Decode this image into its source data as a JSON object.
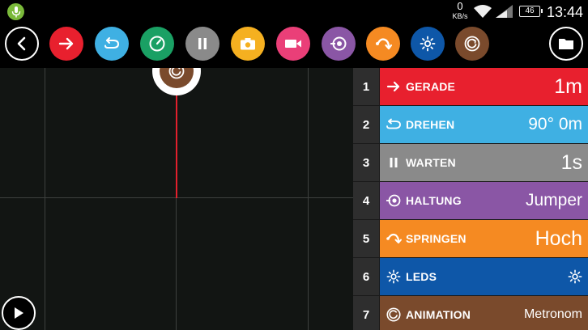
{
  "status_bar": {
    "net_speed_value": "0",
    "net_speed_unit": "KB/s",
    "battery_level": "46",
    "time": "13:44"
  },
  "colors": {
    "red": "#e8202e",
    "light_blue": "#3fb0e3",
    "green": "#1aa064",
    "gray": "#8a8a8a",
    "yellow": "#f5b020",
    "pink": "#ea3f78",
    "purple": "#8a56a5",
    "orange": "#f58a22",
    "blue": "#0e57a8",
    "brown": "#7a4a2c"
  },
  "toolbar": {
    "buttons": [
      {
        "icon": "back-icon"
      },
      {
        "icon": "arrow-right-icon",
        "color": "#e8202e"
      },
      {
        "icon": "rotate-icon",
        "color": "#3fb0e3"
      },
      {
        "icon": "speedometer-icon",
        "color": "#1aa064"
      },
      {
        "icon": "pause-icon",
        "color": "#8a8a8a"
      },
      {
        "icon": "camera-icon",
        "color": "#f5b020"
      },
      {
        "icon": "video-icon",
        "color": "#ea3f78"
      },
      {
        "icon": "posture-icon",
        "color": "#8a56a5"
      },
      {
        "icon": "jump-icon",
        "color": "#f58a22"
      },
      {
        "icon": "leds-icon",
        "color": "#0e57a8"
      },
      {
        "icon": "animation-icon",
        "color": "#7a4a2c"
      },
      {
        "icon": "folder-icon"
      }
    ]
  },
  "commands": [
    {
      "number": "1",
      "label": "GERADE",
      "value": "1m",
      "icon": "arrow-right-icon",
      "color": "#e8202e"
    },
    {
      "number": "2",
      "label": "DREHEN",
      "value": "90° 0m",
      "icon": "rotate-icon",
      "color": "#3fb0e3"
    },
    {
      "number": "3",
      "label": "WARTEN",
      "value": "1s",
      "icon": "pause-icon",
      "color": "#8a8a8a"
    },
    {
      "number": "4",
      "label": "HALTUNG",
      "value": "Jumper",
      "icon": "posture-icon",
      "color": "#8a56a5"
    },
    {
      "number": "5",
      "label": "SPRINGEN",
      "value": "Hoch",
      "icon": "jump-icon",
      "color": "#f58a22"
    },
    {
      "number": "6",
      "label": "LEDS",
      "value": "",
      "icon": "leds-icon",
      "color": "#0e57a8"
    },
    {
      "number": "7",
      "label": "ANIMATION",
      "value": "Metronom",
      "icon": "animation-icon",
      "color": "#7a4a2c"
    }
  ]
}
